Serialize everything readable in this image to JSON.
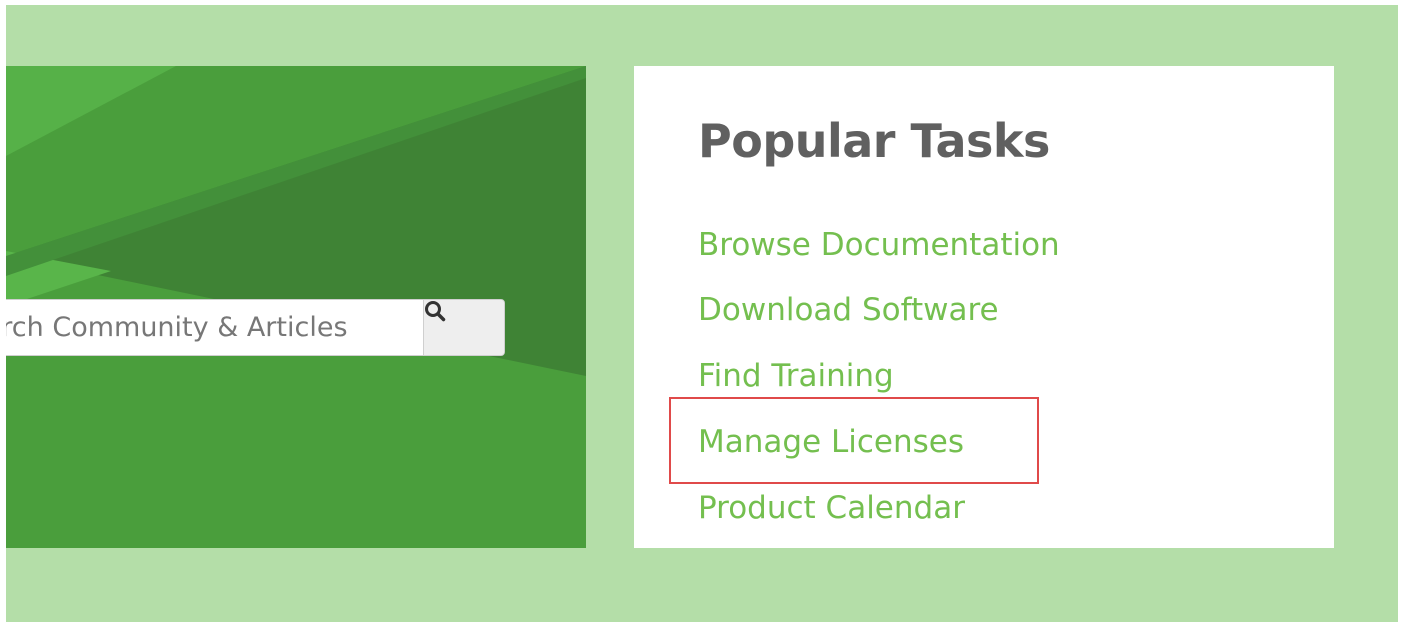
{
  "search": {
    "placeholder": "Search Community & Articles",
    "button_icon": "search-icon"
  },
  "popular_tasks": {
    "title": "Popular Tasks",
    "items": [
      {
        "label": "Browse Documentation"
      },
      {
        "label": "Download Software"
      },
      {
        "label": "Find Training"
      },
      {
        "label": "Manage Licenses"
      },
      {
        "label": "Product Calendar"
      }
    ],
    "highlighted_item": "Manage Licenses"
  },
  "colors": {
    "page_background": "#b4dea8",
    "hero_green": "#4a9e3c",
    "hero_dark_green": "#3f8335",
    "hero_light_green": "#59b54a",
    "card_background": "#ffffff",
    "title_gray": "#606060",
    "link_green": "#74bf4f",
    "highlight_red": "#e04a4a",
    "search_button_gray": "#eeeeee"
  }
}
